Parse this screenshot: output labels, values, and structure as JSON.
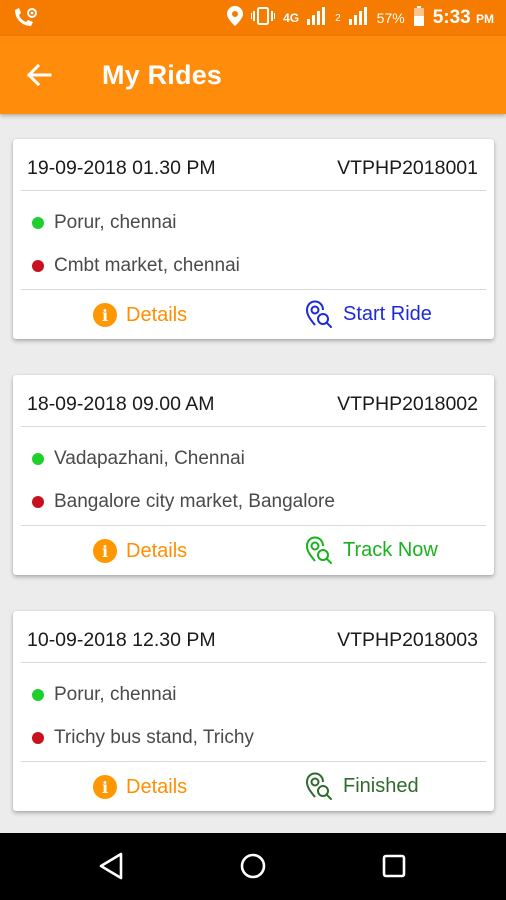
{
  "status_bar": {
    "network": "4G",
    "sim2": "2",
    "battery": "57%",
    "time": "5:33",
    "time_suffix": "PM"
  },
  "app_bar": {
    "title": "My Rides"
  },
  "rides": [
    {
      "date": "19-09-2018 01.30 PM",
      "id": "VTPHP2018001",
      "from": "Porur, chennai",
      "to": "Cmbt market, chennai",
      "details_label": "Details",
      "action_label": "Start Ride",
      "action_color": "#1d2ad8"
    },
    {
      "date": "18-09-2018 09.00 AM",
      "id": "VTPHP2018002",
      "from": "Vadapazhani, Chennai",
      "to": "Bangalore city market, Bangalore",
      "details_label": "Details",
      "action_label": "Track Now",
      "action_color": "#19b21c"
    },
    {
      "date": "10-09-2018 12.30 PM",
      "id": "VTPHP2018003",
      "from": "Porur, chennai",
      "to": "Trichy bus stand, Trichy",
      "details_label": "Details",
      "action_label": "Finished",
      "action_color": "#2e6b2c"
    }
  ],
  "colors": {
    "status_bar": "#f57c00",
    "app_bar": "#ff8c0a",
    "from_dot": "#1fcf2b",
    "to_dot": "#c8101e",
    "details": "#ff8f00"
  }
}
